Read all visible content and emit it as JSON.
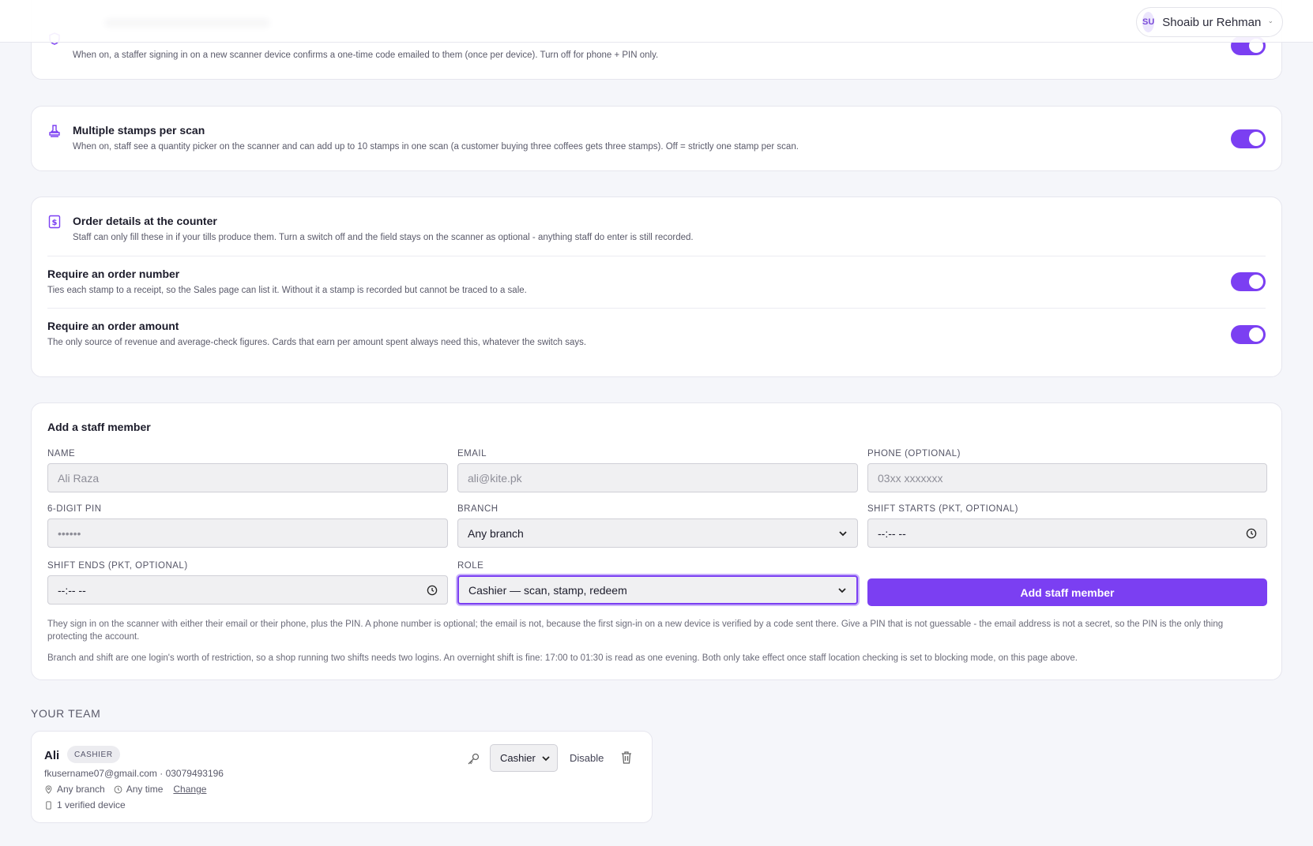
{
  "header": {
    "user_initials": "SU",
    "user_name": "Shoaib ur Rehman"
  },
  "settings": {
    "device_verification": {
      "description": "When on, a staffer signing in on a new scanner device confirms a one-time code emailed to them (once per device). Turn off for phone + PIN only.",
      "enabled": true
    },
    "multiple_stamps": {
      "title": "Multiple stamps per scan",
      "description": "When on, staff see a quantity picker on the scanner and can add up to 10 stamps in one scan (a customer buying three coffees gets three stamps). Off = strictly one stamp per scan.",
      "enabled": true
    },
    "order_details": {
      "title": "Order details at the counter",
      "description": "Staff can only fill these in if your tills produce them. Turn a switch off and the field stays on the scanner as optional - anything staff do enter is still recorded.",
      "order_number": {
        "title": "Require an order number",
        "description": "Ties each stamp to a receipt, so the Sales page can list it. Without it a stamp is recorded but cannot be traced to a sale.",
        "enabled": true
      },
      "order_amount": {
        "title": "Require an order amount",
        "description": "The only source of revenue and average-check figures. Cards that earn per amount spent always need this, whatever the switch says.",
        "enabled": true
      }
    }
  },
  "add_staff": {
    "title": "Add a staff member",
    "name": {
      "label": "NAME",
      "placeholder": "Ali Raza"
    },
    "email": {
      "label": "EMAIL",
      "placeholder": "ali@kite.pk"
    },
    "phone": {
      "label": "PHONE (OPTIONAL)",
      "placeholder": "03xx xxxxxxx"
    },
    "pin": {
      "label": "6-DIGIT PIN",
      "placeholder": "••••••"
    },
    "branch": {
      "label": "BRANCH",
      "value": "Any branch"
    },
    "shift_start": {
      "label": "SHIFT STARTS (PKT, OPTIONAL)",
      "placeholder": "--:-- --"
    },
    "shift_end": {
      "label": "SHIFT ENDS (PKT, OPTIONAL)",
      "placeholder": "--:-- --"
    },
    "role": {
      "label": "ROLE",
      "value": "Cashier — scan, stamp, redeem"
    },
    "submit_label": "Add staff member",
    "help_1": "They sign in on the scanner with either their email or their phone, plus the PIN. A phone number is optional; the email is not, because the first sign-in on a new device is verified by a code sent there. Give a PIN that is not guessable - the email address is not a secret, so the PIN is the only thing protecting the account.",
    "help_2": "Branch and shift are one login's worth of restriction, so a shop running two shifts needs two logins. An overnight shift is fine: 17:00 to 01:30 is read as one evening. Both only take effect once staff location checking is set to blocking mode, on this page above."
  },
  "team": {
    "heading": "YOUR TEAM",
    "members": [
      {
        "name": "Ali",
        "role_badge": "CASHIER",
        "contact": "fkusername07@gmail.com · 03079493196",
        "branch": "Any branch",
        "time": "Any time",
        "change_label": "Change",
        "devices": "1 verified device",
        "role_select": "Cashier",
        "disable_label": "Disable"
      }
    ]
  },
  "colors": {
    "accent": "#7b3ff2",
    "background": "#f5f6fa"
  }
}
